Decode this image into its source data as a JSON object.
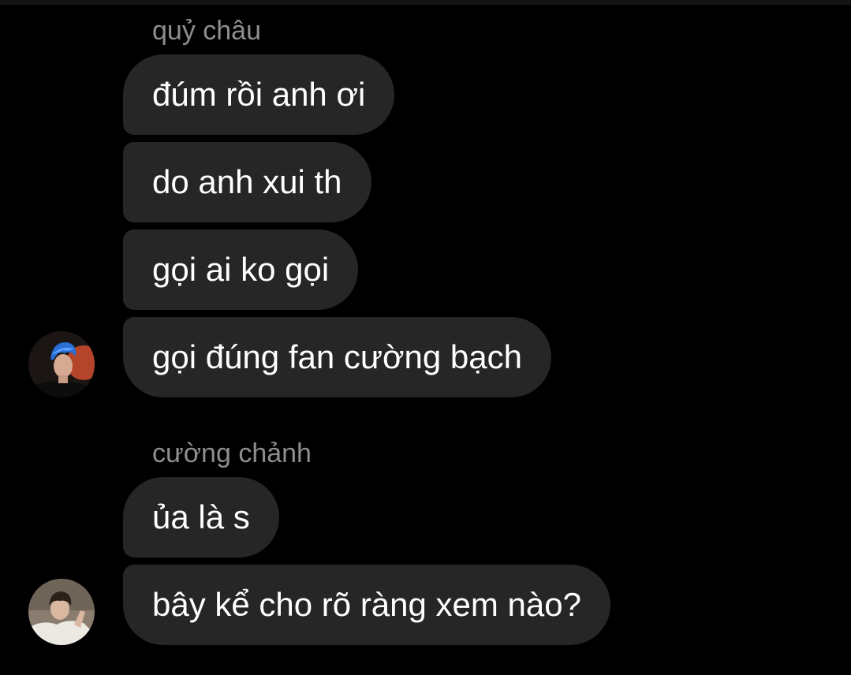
{
  "conversation": {
    "groups": [
      {
        "sender_name": "quỷ châu",
        "messages": [
          "đúm rồi anh ơi",
          "do anh xui th",
          "gọi ai ko gọi",
          "gọi đúng fan cường bạch"
        ],
        "avatar_icon": "profile-photo-blue-hair"
      },
      {
        "sender_name": "cường chảnh",
        "messages": [
          "ủa là s",
          "bây kể cho rõ ràng xem nào?"
        ],
        "avatar_icon": "profile-photo-light"
      }
    ]
  },
  "theme": {
    "background": "#000000",
    "bubble": "#262626",
    "text": "#ffffff",
    "sender_name": "#8e8e8e"
  }
}
